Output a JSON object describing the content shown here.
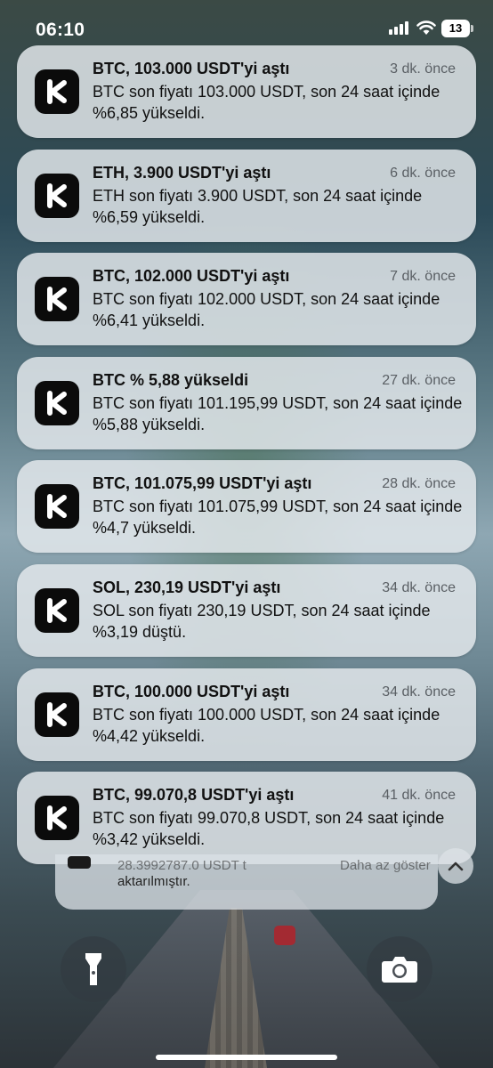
{
  "status_bar": {
    "time": "06:10",
    "battery": "13"
  },
  "notifications": [
    {
      "title": "BTC, 103.000 USDT'yi aştı",
      "time": "3 dk. önce",
      "body": "BTC son fiyatı 103.000 USDT, son 24 saat içinde %6,85 yükseldi."
    },
    {
      "title": "ETH, 3.900 USDT'yi aştı",
      "time": "6 dk. önce",
      "body": "ETH son fiyatı 3.900 USDT, son 24 saat içinde %6,59 yükseldi."
    },
    {
      "title": "BTC, 102.000 USDT'yi aştı",
      "time": "7 dk. önce",
      "body": "BTC son fiyatı 102.000 USDT, son 24 saat içinde %6,41 yükseldi."
    },
    {
      "title": "BTC % 5,88 yükseldi",
      "time": "27 dk. önce",
      "body": "BTC son fiyatı 101.195,99 USDT, son 24 saat içinde %5,88 yükseldi."
    },
    {
      "title": "BTC, 101.075,99 USDT'yi aştı",
      "time": "28 dk. önce",
      "body": "BTC son fiyatı 101.075,99 USDT, son 24 saat içinde %4,7 yükseldi."
    },
    {
      "title": "SOL, 230,19 USDT'yi aştı",
      "time": "34 dk. önce",
      "body": "SOL son fiyatı 230,19 USDT, son 24 saat içinde %3,19 düştü."
    },
    {
      "title": "BTC, 100.000 USDT'yi aştı",
      "time": "34 dk. önce",
      "body": "BTC son fiyatı 100.000 USDT, son 24 saat içinde %4,42 yükseldi."
    },
    {
      "title": "BTC, 99.070,8 USDT'yi aştı",
      "time": "41 dk. önce",
      "body": "BTC son fiyatı 99.070,8 USDT, son 24 saat içinde %3,42 yükseldi."
    }
  ],
  "collapsed": {
    "line1": "28.3992787.0 USDT t",
    "line2": "aktarılmıştır.",
    "show_less": "Daha az göster"
  },
  "icons": {
    "app": "kucoin-k-icon",
    "flashlight": "flashlight-icon",
    "camera": "camera-icon",
    "collapse": "chevron-up-icon"
  }
}
